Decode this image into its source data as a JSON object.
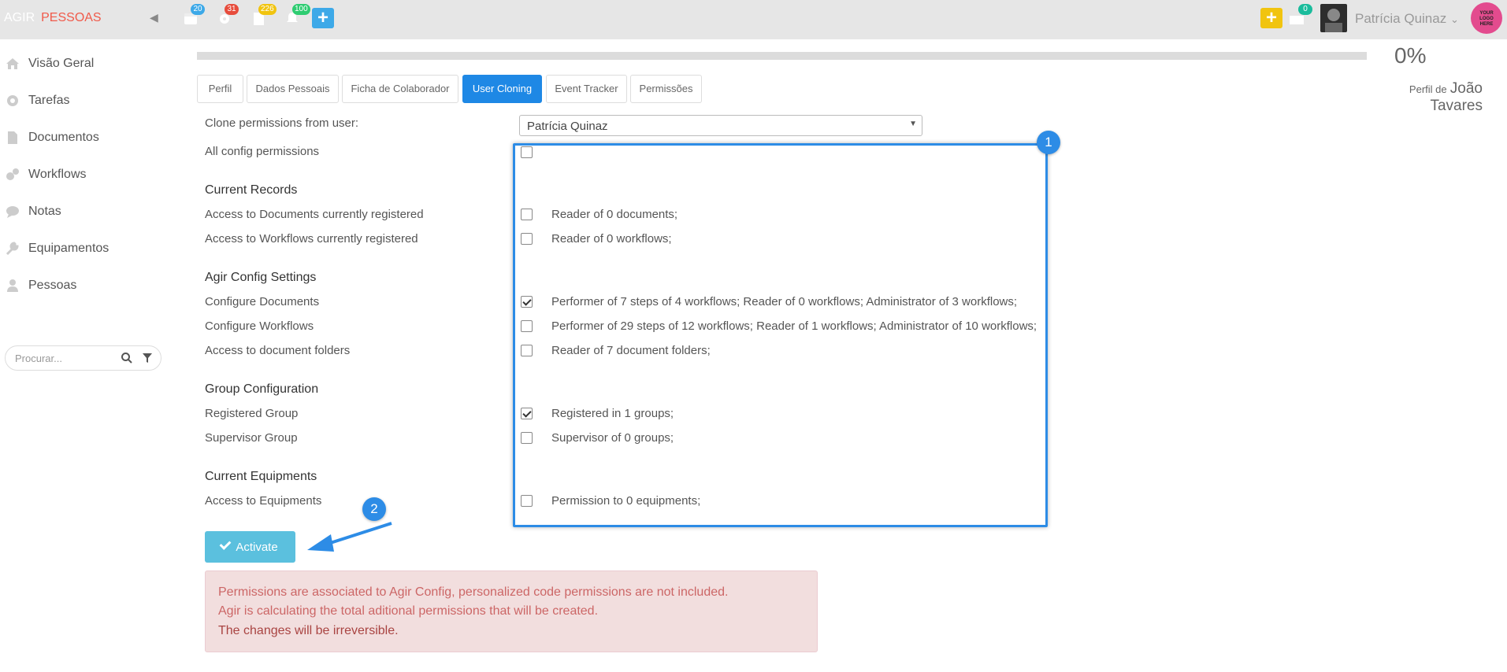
{
  "topbar": {
    "brand_part1": "AGIR",
    "brand_part2": "PESSOAS",
    "badges": {
      "calendar": "20",
      "settings": "31",
      "documents": "226",
      "notifications": "100",
      "messages": "0"
    },
    "username": "Patrícia Quinaz",
    "logo_text": "YOUR LOGO HERE"
  },
  "sidebar": {
    "items": [
      {
        "label": "Visão Geral",
        "icon": "home-icon"
      },
      {
        "label": "Tarefas",
        "icon": "gear-icon"
      },
      {
        "label": "Documentos",
        "icon": "document-icon"
      },
      {
        "label": "Workflows",
        "icon": "gears-icon"
      },
      {
        "label": "Notas",
        "icon": "chat-icon"
      },
      {
        "label": "Equipamentos",
        "icon": "wrench-icon"
      },
      {
        "label": "Pessoas",
        "icon": "user-icon"
      }
    ],
    "search_placeholder": "Procurar..."
  },
  "progress": {
    "value_percent": 0,
    "label": "0%"
  },
  "profile": {
    "prefix": "Perfil de",
    "name": "João Tavares"
  },
  "tabs": [
    {
      "label": "Perfil"
    },
    {
      "label": "Dados Pessoais"
    },
    {
      "label": "Ficha de Colaborador"
    },
    {
      "label": "User Cloning",
      "active": true
    },
    {
      "label": "Event Tracker"
    },
    {
      "label": "Permissões"
    }
  ],
  "form": {
    "clone_label": "Clone permissions from user:",
    "clone_value": "Patrícia Quinaz",
    "all_config_label": "All config permissions",
    "all_config_checked": false,
    "sections": {
      "current_records": "Current Records",
      "agir_config": "Agir Config Settings",
      "group_config": "Group Configuration",
      "current_equipments": "Current Equipments"
    },
    "rows": {
      "docs_registered": {
        "label": "Access to Documents currently registered",
        "desc": "Reader of 0 documents;",
        "checked": false
      },
      "wf_registered": {
        "label": "Access to Workflows currently registered",
        "desc": "Reader of 0 workflows;",
        "checked": false
      },
      "config_docs": {
        "label": "Configure Documents",
        "desc": "Performer of 7 steps of 4 workflows; Reader of 0 workflows; Administrator of 3 workflows;",
        "checked": true
      },
      "config_wf": {
        "label": "Configure Workflows",
        "desc": "Performer of 29 steps of 12 workflows; Reader of 1 workflows; Administrator of 10 workflows;",
        "checked": false
      },
      "doc_folders": {
        "label": "Access to document folders",
        "desc": "Reader of 7 document folders;",
        "checked": false
      },
      "registered_group": {
        "label": "Registered Group",
        "desc": "Registered in 1 groups;",
        "checked": true
      },
      "supervisor_group": {
        "label": "Supervisor Group",
        "desc": "Supervisor of 0 groups;",
        "checked": false
      },
      "equipments": {
        "label": "Access to Equipments",
        "desc": "Permission to 0 equipments;",
        "checked": false
      }
    },
    "activate_label": "Activate"
  },
  "annotations": {
    "one": "1",
    "two": "2"
  },
  "alert": {
    "line1": "Permissions are associated to Agir Config, personalized code permissions are not included.",
    "line2": "Agir is calculating the total aditional permissions that will be created.",
    "line3": "The changes will be irreversible."
  },
  "colors": {
    "accent": "#1e88e5",
    "brand_red": "#f05a4a",
    "info_button": "#5bc0de",
    "alert_bg": "#f2dede",
    "annotation": "#2d8ce6"
  }
}
